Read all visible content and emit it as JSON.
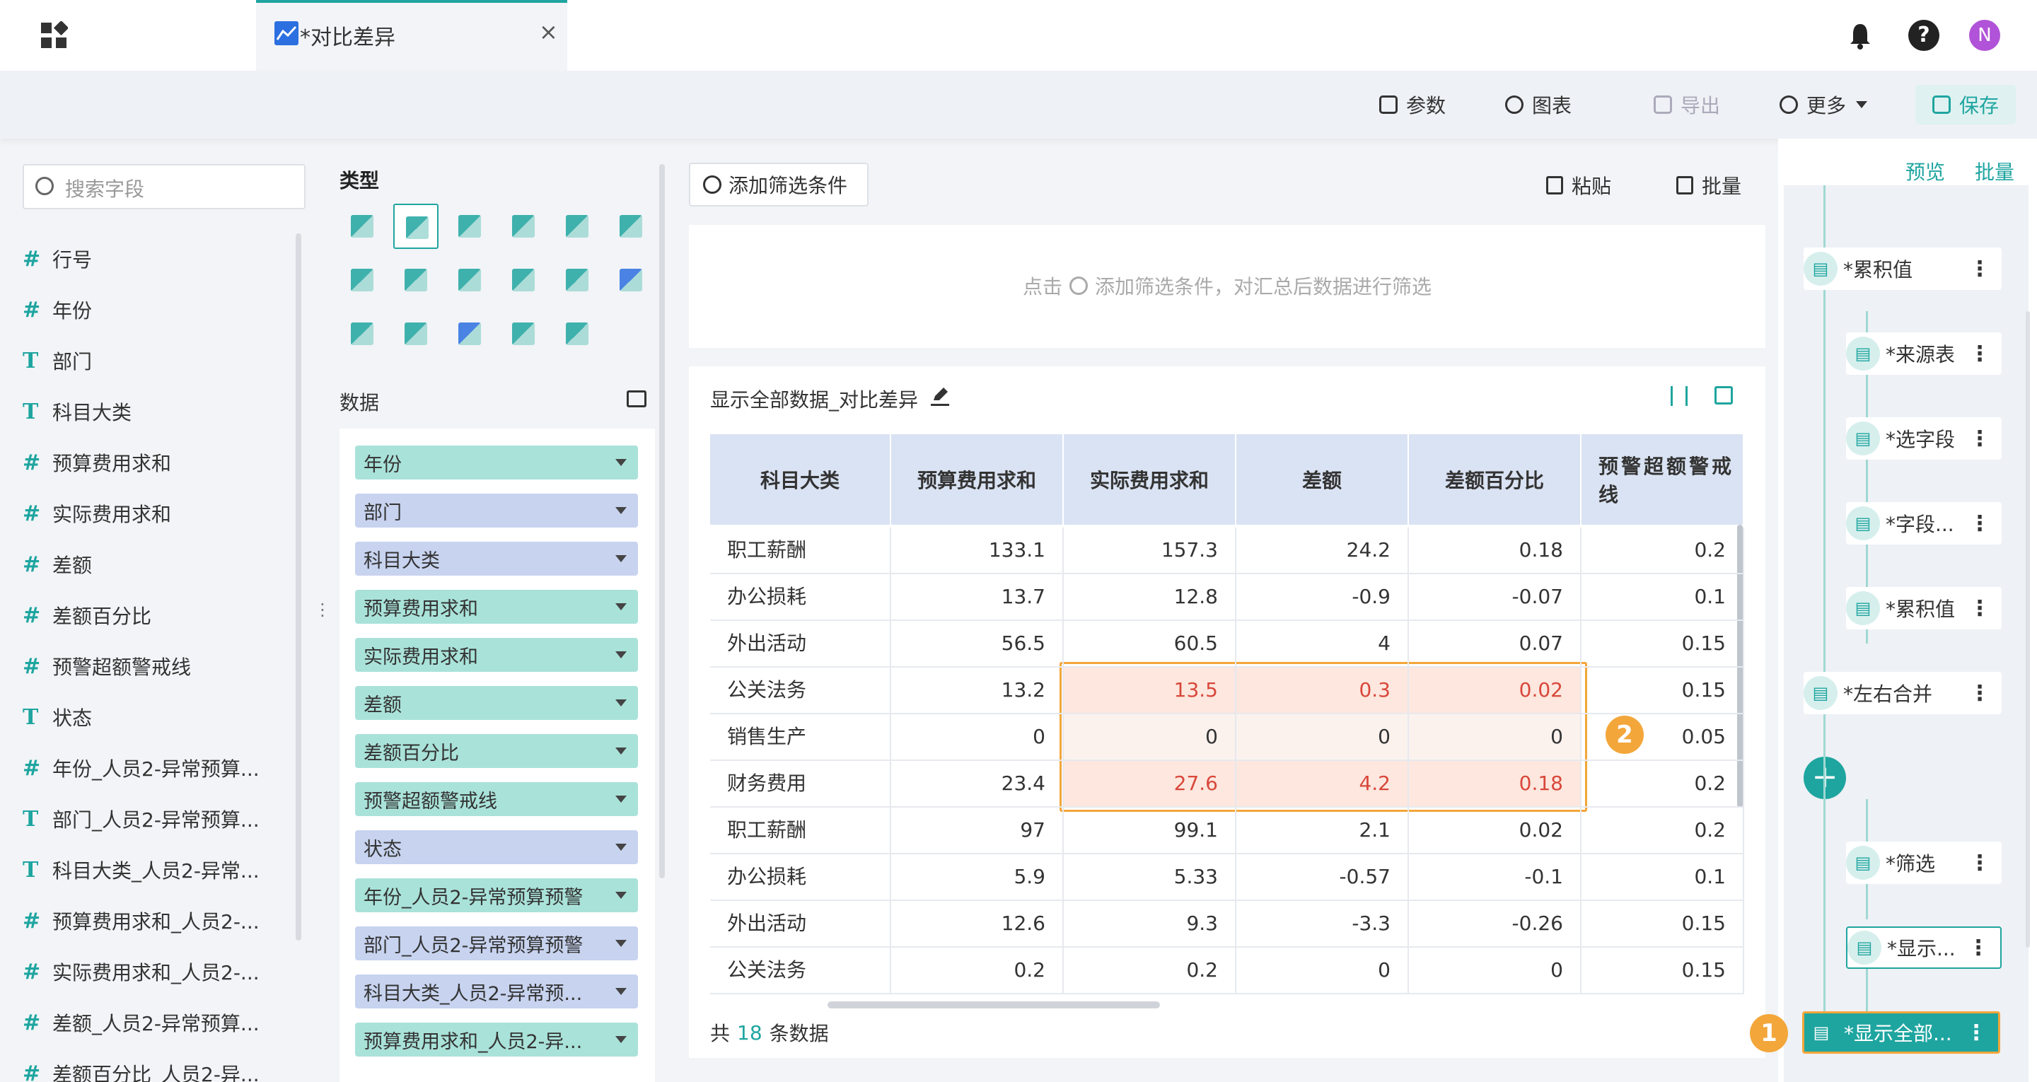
{
  "tab": {
    "title": "*对比差异",
    "close": "×"
  },
  "top_icons": {
    "help": "?",
    "avatar": "N"
  },
  "toolbar": {
    "params": "参数",
    "chart": "图表",
    "export": "导出",
    "more": "更多",
    "save": "保存"
  },
  "search": {
    "placeholder": "搜索字段"
  },
  "fields": [
    {
      "type": "#",
      "label": "行号"
    },
    {
      "type": "#",
      "label": "年份"
    },
    {
      "type": "T",
      "label": "部门"
    },
    {
      "type": "T",
      "label": "科目大类"
    },
    {
      "type": "#",
      "label": "预算费用求和"
    },
    {
      "type": "#",
      "label": "实际费用求和"
    },
    {
      "type": "#",
      "label": "差额"
    },
    {
      "type": "#",
      "label": "差额百分比"
    },
    {
      "type": "#",
      "label": "预警超额警戒线"
    },
    {
      "type": "T",
      "label": "状态"
    },
    {
      "type": "#",
      "label": "年份_人员2-异常预算..."
    },
    {
      "type": "T",
      "label": "部门_人员2-异常预算..."
    },
    {
      "type": "T",
      "label": "科目大类_人员2-异常..."
    },
    {
      "type": "#",
      "label": "预算费用求和_人员2-..."
    },
    {
      "type": "#",
      "label": "实际费用求和_人员2-..."
    },
    {
      "type": "#",
      "label": "差额_人员2-异常预算..."
    },
    {
      "type": "#",
      "label": "差额百分比_人员2-异..."
    }
  ],
  "config": {
    "type_title": "类型",
    "data_title": "数据",
    "type_icons": [
      "table-icon",
      "detail-table-icon",
      "bar-chart-icon",
      "stacked-bar-icon",
      "combo-icon",
      "pie-icon",
      "area-icon",
      "map-icon",
      "gauge-icon",
      "grouped-bar-icon",
      "scatter-icon",
      "card-grid-icon",
      "radar-icon",
      "funnel-icon",
      "number-icon",
      "text-icon",
      "heatmap-icon"
    ],
    "pills": [
      {
        "label": "年份",
        "color": "g"
      },
      {
        "label": "部门",
        "color": "b"
      },
      {
        "label": "科目大类",
        "color": "b"
      },
      {
        "label": "预算费用求和",
        "color": "g"
      },
      {
        "label": "实际费用求和",
        "color": "g"
      },
      {
        "label": "差额",
        "color": "g"
      },
      {
        "label": "差额百分比",
        "color": "g"
      },
      {
        "label": "预警超额警戒线",
        "color": "g"
      },
      {
        "label": "状态",
        "color": "b"
      },
      {
        "label": "年份_人员2-异常预算预警",
        "color": "g"
      },
      {
        "label": "部门_人员2-异常预算预警",
        "color": "b"
      },
      {
        "label": "科目大类_人员2-异常预...",
        "color": "b"
      },
      {
        "label": "预算费用求和_人员2-异...",
        "color": "g"
      }
    ]
  },
  "filter": {
    "add_label": "添加筛选条件",
    "paste": "粘贴",
    "batch": "批量",
    "hint_pre": "点击",
    "hint_post": "添加筛选条件，对汇总后数据进行筛选"
  },
  "table": {
    "title": "显示全部数据_对比差异",
    "columns": [
      "科目大类",
      "预算费用求和",
      "实际费用求和",
      "差额",
      "差额百分比",
      "预警超额警戒线"
    ],
    "rows": [
      [
        "职工薪酬",
        "133.1",
        "157.3",
        "24.2",
        "0.18",
        "0.2"
      ],
      [
        "办公损耗",
        "13.7",
        "12.8",
        "-0.9",
        "-0.07",
        "0.1"
      ],
      [
        "外出活动",
        "56.5",
        "60.5",
        "4",
        "0.07",
        "0.15"
      ],
      [
        "公关法务",
        "13.2",
        "13.5",
        "0.3",
        "0.02",
        "0.15"
      ],
      [
        "销售生产",
        "0",
        "0",
        "0",
        "0",
        "0.05"
      ],
      [
        "财务费用",
        "23.4",
        "27.6",
        "4.2",
        "0.18",
        "0.2"
      ],
      [
        "职工薪酬",
        "97",
        "99.1",
        "2.1",
        "0.02",
        "0.2"
      ],
      [
        "办公损耗",
        "5.9",
        "5.33",
        "-0.57",
        "-0.1",
        "0.1"
      ],
      [
        "外出活动",
        "12.6",
        "9.3",
        "-3.3",
        "-0.26",
        "0.15"
      ],
      [
        "公关法务",
        "0.2",
        "0.2",
        "0",
        "0",
        "0.15"
      ]
    ],
    "total_pre": "共",
    "total_count": "18",
    "total_post": "条数据",
    "badge": "2"
  },
  "flow": {
    "preview": "预览",
    "batch": "批量",
    "nodes": [
      {
        "label": "*累积值",
        "icon": "accumulate-icon"
      },
      {
        "label": "*来源表",
        "icon": "source-table-icon"
      },
      {
        "label": "*选字段",
        "icon": "select-fields-icon"
      },
      {
        "label": "*字段...",
        "icon": "field-settings-icon"
      },
      {
        "label": "*累积值",
        "icon": "accumulate-icon"
      },
      {
        "label": "*左右合并",
        "icon": "merge-icon"
      },
      {
        "label": "*筛选",
        "icon": "filter-icon"
      },
      {
        "label": "*显示...",
        "icon": "table-icon"
      },
      {
        "label": "*显示全部...",
        "icon": "table-icon"
      }
    ],
    "add": "+",
    "badge": "1",
    "dots": "⋮"
  },
  "colors": {
    "accent": "#1fa5a0",
    "highlight": "#f3a63a",
    "negative_red": "#d9473b",
    "pill_green": "#a9e2d9",
    "pill_blue": "#c7d3ef",
    "header_blue": "#dae3f3"
  }
}
